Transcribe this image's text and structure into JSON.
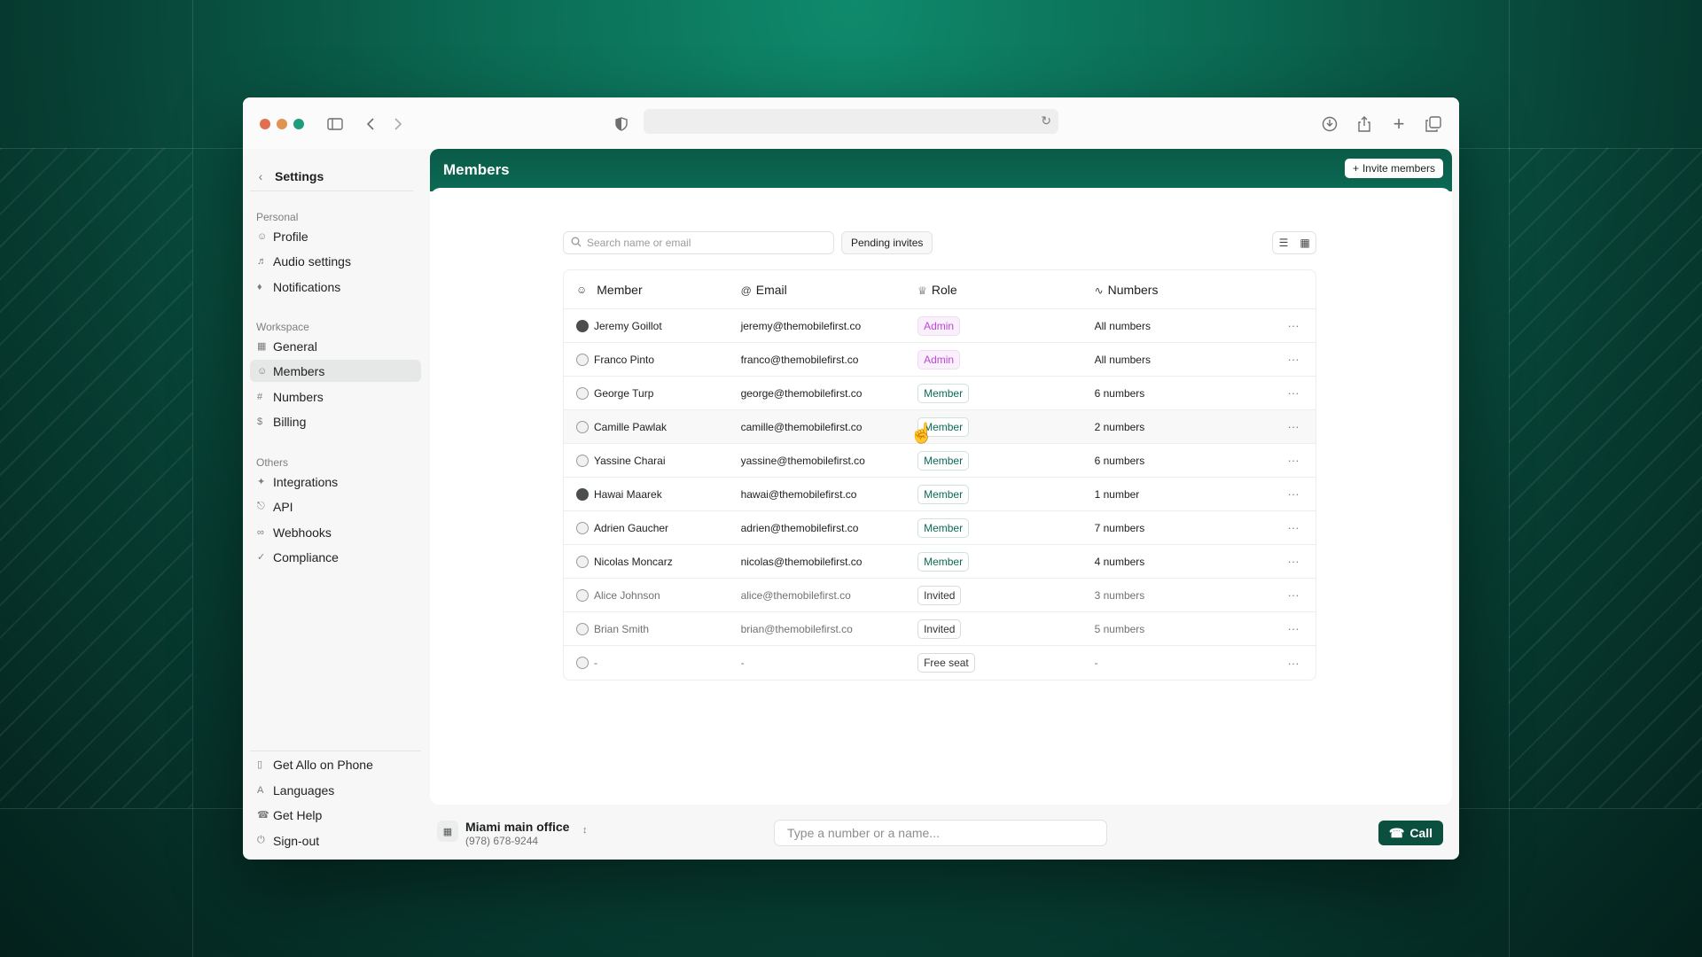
{
  "browser": {
    "traffic_light_colors": [
      "#e06f52",
      "#e09352",
      "#1f9c7a"
    ],
    "icons": [
      "sidebar-toggle-icon",
      "back-icon",
      "forward-icon",
      "shield-icon",
      "reload-icon",
      "download-icon",
      "share-icon",
      "new-tab-icon",
      "tabs-icon"
    ]
  },
  "sidebar": {
    "back_label": "Settings",
    "sections": {
      "personal": "Personal",
      "workspace": "Workspace",
      "others": "Others"
    },
    "personal_items": [
      {
        "label": "Profile",
        "icon": "user-icon"
      },
      {
        "label": "Audio settings",
        "icon": "speaker-icon"
      },
      {
        "label": "Notifications",
        "icon": "bell-icon"
      }
    ],
    "workspace_items": [
      {
        "label": "General",
        "icon": "building-icon"
      },
      {
        "label": "Members",
        "icon": "users-icon"
      },
      {
        "label": "Numbers",
        "icon": "hash-icon"
      },
      {
        "label": "Billing",
        "icon": "dollar-icon"
      }
    ],
    "others_items": [
      {
        "label": "Integrations",
        "icon": "integrations-icon"
      },
      {
        "label": "API",
        "icon": "api-icon"
      },
      {
        "label": "Webhooks",
        "icon": "link-icon"
      },
      {
        "label": "Compliance",
        "icon": "shield-check-icon"
      }
    ],
    "footer_items": [
      {
        "label": "Get Allo on Phone",
        "icon": "phone-device-icon"
      },
      {
        "label": "Languages",
        "icon": "translate-icon"
      },
      {
        "label": "Get Help",
        "icon": "headset-icon"
      },
      {
        "label": "Sign-out",
        "icon": "power-icon"
      }
    ]
  },
  "main": {
    "title": "Members",
    "invite_button": "Invite members",
    "search_placeholder": "Search name or email",
    "pending_invites": "Pending invites",
    "columns": [
      "Member",
      "Email",
      "Role",
      "Numbers"
    ],
    "rows": [
      {
        "name": "Jeremy Goillot",
        "email": "jeremy@themobilefirst.co",
        "role": "Admin",
        "role_type": "admin",
        "numbers": "All numbers"
      },
      {
        "name": "Franco Pinto",
        "email": "franco@themobilefirst.co",
        "role": "Admin",
        "role_type": "admin",
        "numbers": "All numbers"
      },
      {
        "name": "George Turp",
        "email": "george@themobilefirst.co",
        "role": "Member",
        "role_type": "member",
        "numbers": "6 numbers"
      },
      {
        "name": "Camille Pawlak",
        "email": "camille@themobilefirst.co",
        "role": "Member",
        "role_type": "member",
        "numbers": "2 numbers"
      },
      {
        "name": "Yassine Charai",
        "email": "yassine@themobilefirst.co",
        "role": "Member",
        "role_type": "member",
        "numbers": "6 numbers"
      },
      {
        "name": "Hawai Maarek",
        "email": "hawai@themobilefirst.co",
        "role": "Member",
        "role_type": "member",
        "numbers": "1 number"
      },
      {
        "name": "Adrien Gaucher",
        "email": "adrien@themobilefirst.co",
        "role": "Member",
        "role_type": "member",
        "numbers": "7 numbers"
      },
      {
        "name": "Nicolas Moncarz",
        "email": "nicolas@themobilefirst.co",
        "role": "Member",
        "role_type": "member",
        "numbers": "4 numbers"
      },
      {
        "name": "Alice Johnson",
        "email": "alice@themobilefirst.co",
        "role": "Invited",
        "role_type": "invited",
        "numbers": "3 numbers"
      },
      {
        "name": "Brian Smith",
        "email": "brian@themobilefirst.co",
        "role": "Invited",
        "role_type": "invited",
        "numbers": "5 numbers"
      },
      {
        "name": "-",
        "email": "-",
        "role": "Free seat",
        "role_type": "free",
        "numbers": "-"
      }
    ],
    "row_menu": "···"
  },
  "bottom_bar": {
    "office_name": "Miami main office",
    "office_number": "(978) 678-9244",
    "dial_placeholder": "Type a number or a name...",
    "call_button": "Call"
  },
  "colors": {
    "brand": "#0b6a54",
    "admin": "#b94ad6",
    "call_button": "#0b4f3f"
  }
}
